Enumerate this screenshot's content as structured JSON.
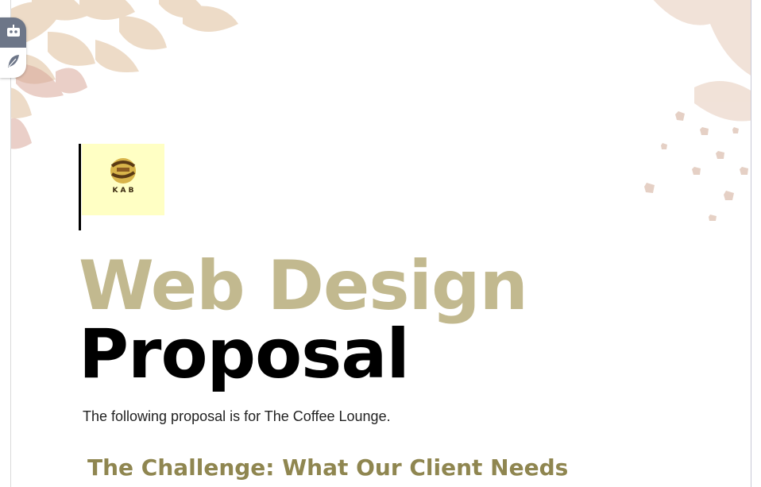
{
  "document": {
    "title_line1": "Web Design",
    "title_line2": "Proposal",
    "intro": "The following proposal is for The Coffee Lounge.",
    "section_heading": "The Challenge: What Our Client Needs",
    "logo_text": "K A B"
  },
  "toolbar": {
    "items": [
      {
        "icon": "robot-icon"
      },
      {
        "icon": "feather-icon"
      }
    ]
  },
  "colors": {
    "title_accent": "#c2b98f",
    "heading": "#8f8650",
    "logo_bg": "#ffffc4",
    "toolbar_bg": "#6d7688"
  }
}
